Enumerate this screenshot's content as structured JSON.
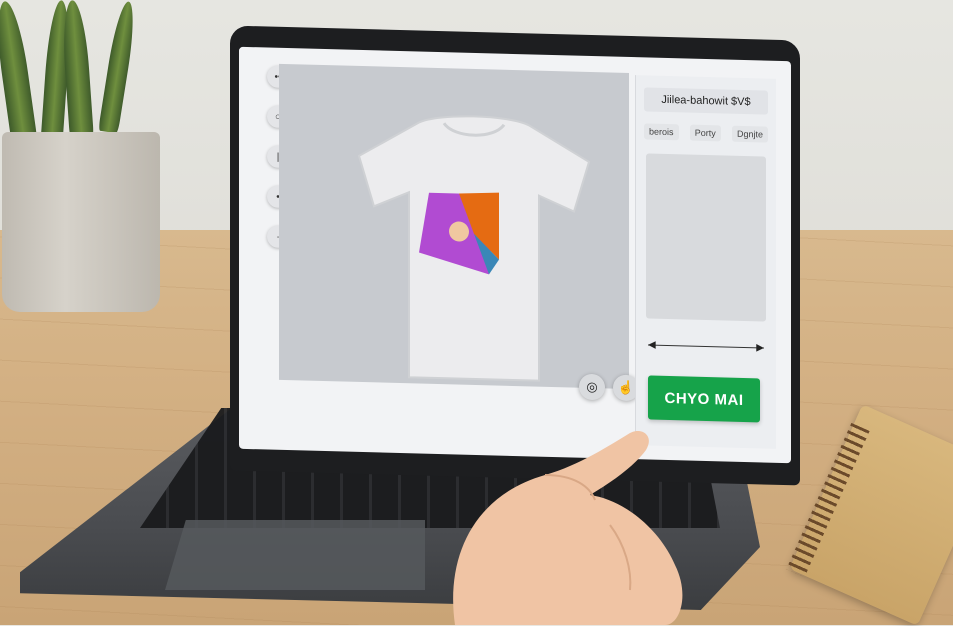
{
  "ui": {
    "title": "Jiilea-bahowit $V$",
    "tabs": [
      "berois",
      "Porty",
      "Dgnjte"
    ],
    "toolbar_icons": [
      "select-icon",
      "shape-icon",
      "text-icon",
      "color-icon",
      "layer-icon"
    ],
    "canvas_controls": [
      "circle-icon",
      "hand-icon"
    ],
    "cta_label": "CHYO MAI"
  },
  "colors": {
    "accent": "#16a34a",
    "design_magenta": "#b14bd2",
    "design_orange": "#e56b12",
    "design_teal": "#3a87b7"
  }
}
